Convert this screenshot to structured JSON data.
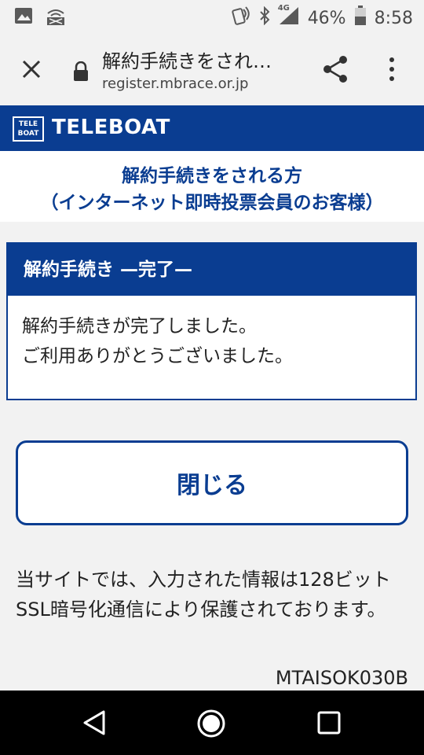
{
  "status_bar": {
    "battery_percent": "46%",
    "time": "8:58",
    "network_label": "4G",
    "icons": [
      "gallery-icon",
      "wifi-calling-icon",
      "nfc-icon",
      "bluetooth-icon",
      "signal-icon",
      "battery-icon"
    ]
  },
  "browser": {
    "page_title": "解約手続きをされ…",
    "domain": "register.mbrace.or.jp",
    "icons": [
      "close-icon",
      "lock-icon",
      "share-icon",
      "more-vert-icon"
    ]
  },
  "brand": {
    "logo_top": "TELE",
    "logo_bottom": "BOAT",
    "name": "TELEBOAT",
    "color": "#0a3d91"
  },
  "headline": {
    "line1": "解約手続きをされる方",
    "line2": "（インターネット即時投票会員のお客様）"
  },
  "card": {
    "title": "解約手続き —完了—",
    "line1": "解約手続きが完了しました。",
    "line2": "ご利用ありがとうございました。"
  },
  "actions": {
    "close_label": "閉じる"
  },
  "note": {
    "text": "当サイトでは、入力された情報は128ビットSSL暗号化通信により保護されております。"
  },
  "screen_code": "MTAISOK030B",
  "nav": {
    "icons": [
      "back-icon",
      "home-icon",
      "recents-icon"
    ]
  }
}
